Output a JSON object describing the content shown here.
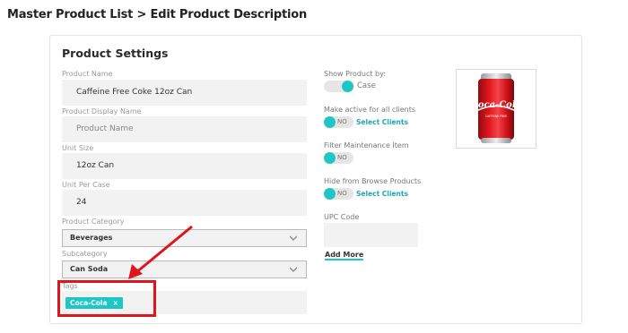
{
  "breadcrumb": "Master Product List > Edit Product Description",
  "card_title": "Product Settings",
  "fields": {
    "product_name": {
      "label": "Product Name",
      "value": "Caffeine Free Coke 12oz Can"
    },
    "display_name": {
      "label": "Product Display Name",
      "placeholder": "Product Name"
    },
    "unit_size": {
      "label": "Unit Size",
      "value": "12oz Can"
    },
    "unit_per_case": {
      "label": "Unit Per Case",
      "value": "24"
    },
    "category": {
      "label": "Product Category",
      "value": "Beverages"
    },
    "subcategory": {
      "label": "Subcategory",
      "value": "Can Soda"
    },
    "tags": {
      "label": "Tags",
      "items": [
        {
          "label": "Coca-Cola",
          "remove": "×"
        }
      ]
    }
  },
  "right": {
    "show_by": {
      "label": "Show Product by:",
      "toggle_text": "Case"
    },
    "active_all": {
      "label": "Make active for all clients",
      "toggle_text": "NO",
      "link": "Select Clients"
    },
    "filter_maint": {
      "label": "Filter Maintenance Item",
      "toggle_text": "NO"
    },
    "hide_browse": {
      "label": "Hide from Browse Products",
      "toggle_text": "NO",
      "link": "Select Clients"
    },
    "upc": {
      "label": "UPC Code"
    },
    "add_more": "Add More"
  },
  "product_image": {
    "brand_text": "Coca-Cola",
    "sub_text": "CAFFEINE FREE"
  },
  "colors": {
    "accent": "#1ec6c6",
    "annotation": "#e0151b"
  }
}
